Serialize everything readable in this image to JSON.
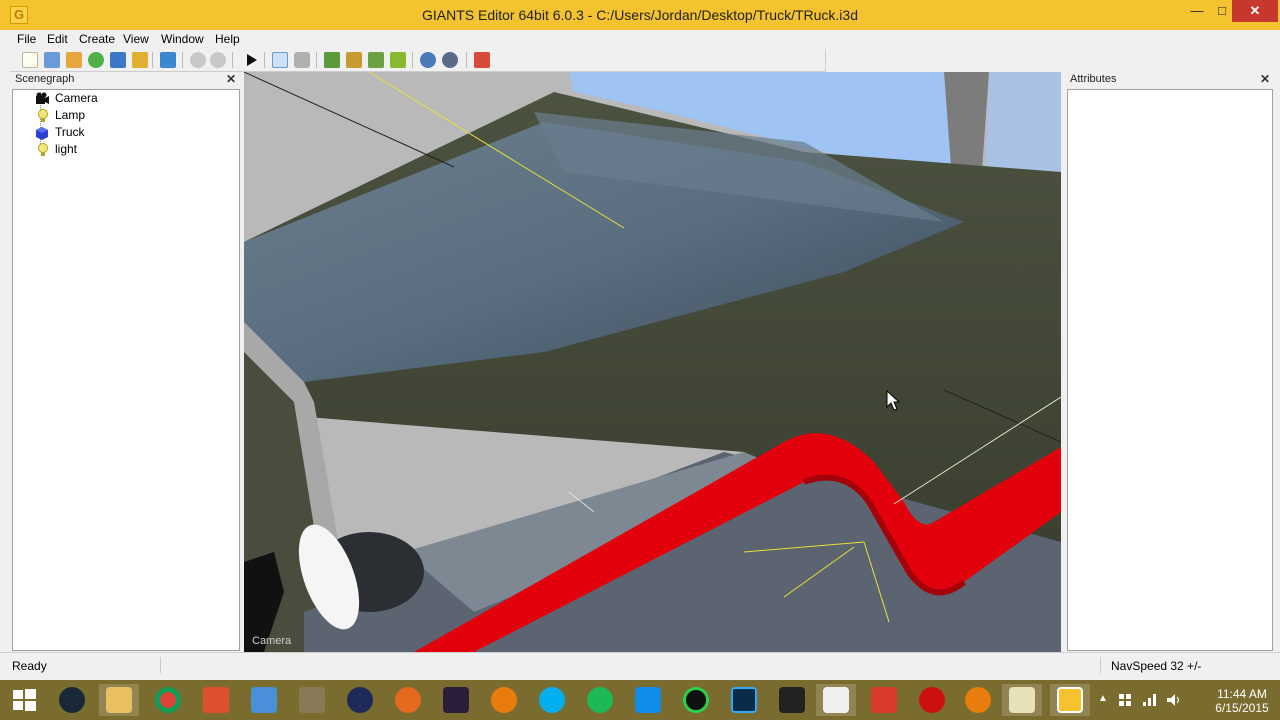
{
  "window": {
    "title": "GIANTS Editor 64bit 6.0.3 - C:/Users/Jordan/Desktop/Truck/TRuck.i3d",
    "app_icon_letter": "G",
    "minimize": "—",
    "maximize": "□",
    "close": "✕"
  },
  "menu": {
    "file": "File",
    "edit": "Edit",
    "create": "Create",
    "view": "View",
    "window": "Window",
    "help": "Help"
  },
  "toolbar": {
    "icons": [
      "new-file-icon",
      "open-file-icon",
      "edit-icon",
      "reload-icon",
      "save-icon",
      "export-icon",
      "import-icon",
      "undo-icon",
      "redo-icon",
      "play-icon",
      "select-icon",
      "magnet-icon",
      "terrain-icon",
      "paint-icon",
      "foliage-icon",
      "plant-icon",
      "settings-icon",
      "settings-alt-icon",
      "script-icon"
    ]
  },
  "scenegraph": {
    "title": "Scenegraph",
    "close": "✕",
    "items": [
      {
        "label": "Camera",
        "icon": "camera-icon"
      },
      {
        "label": "Lamp",
        "icon": "light-bulb-icon"
      },
      {
        "label": "Truck",
        "icon": "shape-cube-icon"
      },
      {
        "label": "light",
        "icon": "light-bulb-icon"
      }
    ]
  },
  "attributes": {
    "title": "Attributes",
    "close": "✕"
  },
  "viewport": {
    "camera_label": "Camera"
  },
  "status": {
    "ready": "Ready",
    "navspeed": "NavSpeed 32 +/-"
  },
  "taskbar": {
    "apps": [
      "start-icon",
      "steam-icon",
      "file-explorer-icon",
      "chrome-icon",
      "paint-icon",
      "control-panel-icon",
      "gimp-icon",
      "cinema4d-icon",
      "firefox-icon",
      "after-effects-icon",
      "blender-icon",
      "skype-icon",
      "spotify-icon",
      "teamviewer-icon",
      "obs-icon",
      "photoshop-icon",
      "movie-maker-icon",
      "word-icon",
      "sketchup-icon",
      "record-icon",
      "blender-alt-icon",
      "giants-chart-icon",
      "giants-editor-icon"
    ],
    "time": "11:44 AM",
    "date": "6/15/2015"
  },
  "colors": {
    "titlebar": "#f5c330",
    "taskbar": "#7a6b2e",
    "close_red": "#c7372e",
    "truck_red": "#e3000d"
  }
}
